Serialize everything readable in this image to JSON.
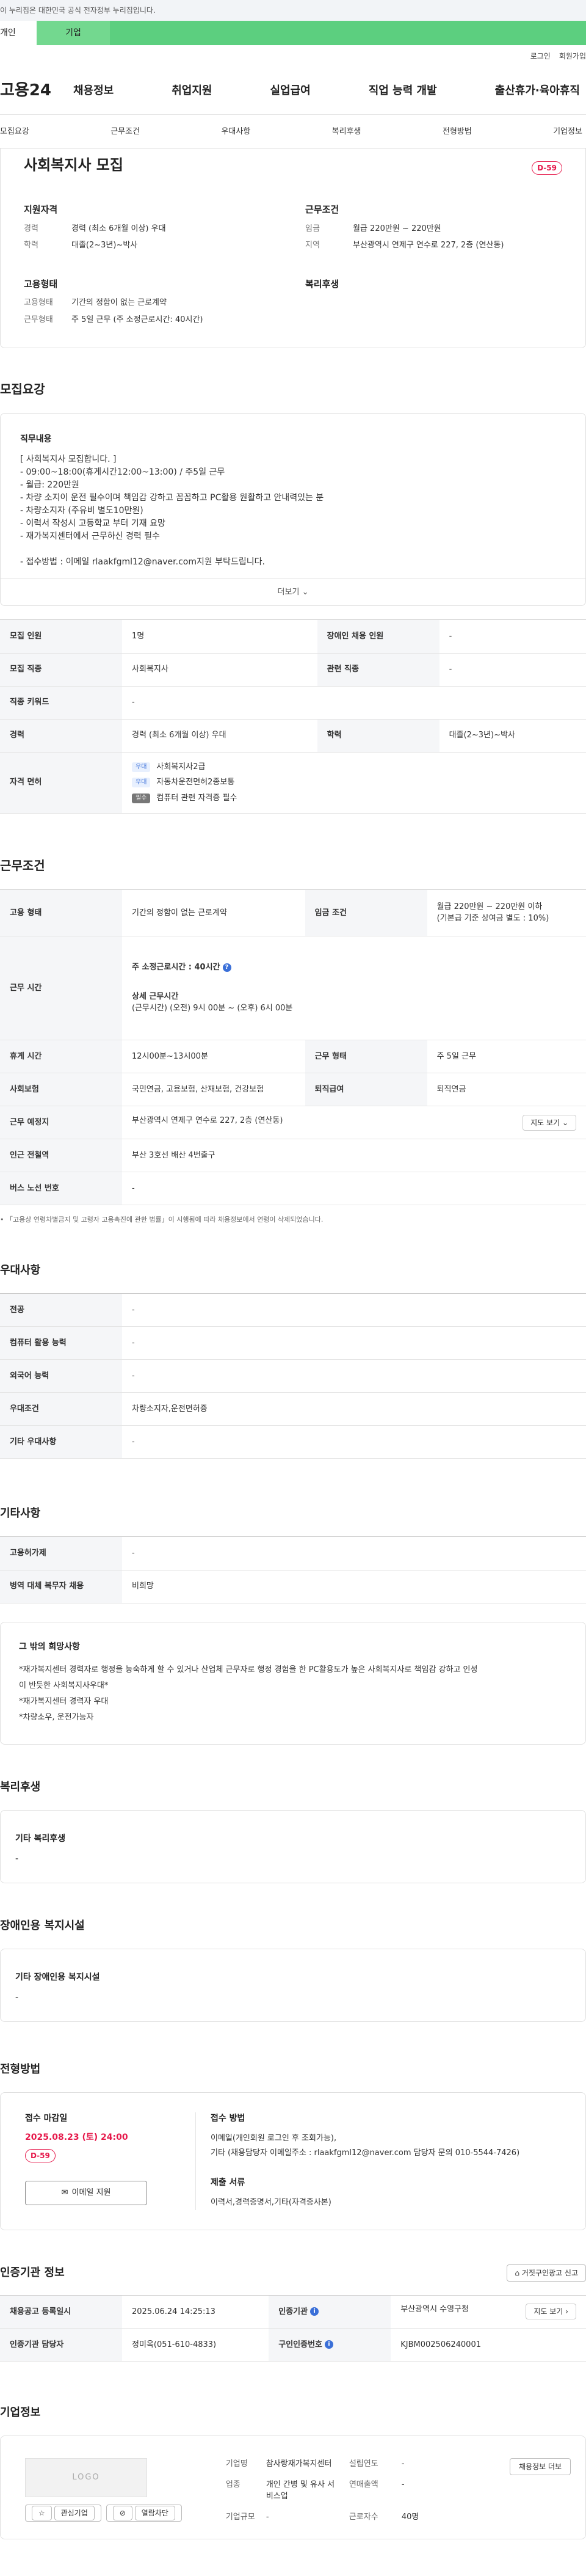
{
  "notice": "이 누리집은 대한민국 공식 전자정부 누리집입니다.",
  "user_tabs": [
    "개인",
    "기업"
  ],
  "util": [
    "로그인",
    "회원가입"
  ],
  "logo": "고용24",
  "gnb": [
    "채용정보",
    "취업지원",
    "실업급여",
    "직업 능력 개발",
    "출산휴가·육아휴직"
  ],
  "subnav": [
    "모집요강",
    "근무조건",
    "우대사항",
    "복리후생",
    "전형방법",
    "기업정보"
  ],
  "summary": {
    "title": "사회복지사 모집",
    "dday": "D-59",
    "qual": {
      "title": "지원자격",
      "rows": [
        {
          "k": "경력",
          "v": "경력 (최소 6개월 이상) 우대"
        },
        {
          "k": "학력",
          "v": "대졸(2~3년)~박사"
        }
      ]
    },
    "cond": {
      "title": "근무조건",
      "rows": [
        {
          "k": "임금",
          "v": "월급 220만원 ~ 220만원"
        },
        {
          "k": "지역",
          "v": "부산광역시 연제구 연수로 227, 2층 (연산동)"
        }
      ]
    },
    "emp": {
      "title": "고용형태",
      "rows": [
        {
          "k": "고용형태",
          "v": "기간의 정함이 없는 근로계약"
        },
        {
          "k": "근무형태",
          "v": "주 5일 근무 (주 소정근로시간: 40시간)"
        }
      ]
    },
    "welfare": {
      "title": "복리후생"
    }
  },
  "recruit": {
    "title": "모집요강",
    "desc_title": "직무내용",
    "desc_lines": [
      "[ 사회복지사 모집합니다. ]",
      "- 09:00~18:00(휴게시간12:00~13:00) / 주5일 근무",
      "- 월급: 220만원",
      "- 차량 소지이 운전 필수이며 책임감 강하고 꼼꼼하고 PC활용 원활하고 안내력있는 분",
      "- 차량소지자 (주유비 별도10만원)",
      "- 이력서 작성시 고등학교 부터 기재 요망",
      "- 재가복지센터에서 근무하신 경력 필수",
      "",
      "- 접수방법 : 이메일 rlaakfgml12@naver.com지원 부탁드립니다."
    ],
    "more": "더보기",
    "headcount_label": "모집 인원",
    "headcount": "1명",
    "disabled_label": "장애인 채용 인원",
    "disabled": "-",
    "job_label": "모집 직종",
    "job": "사회복지사",
    "related_label": "관련 직종",
    "related": "-",
    "keyword_label": "직종 키워드",
    "keyword": "-",
    "career_label": "경력",
    "career": "경력 (최소 6개월 이상) 우대",
    "edu_label": "학력",
    "edu": "대졸(2~3년)~박사",
    "license_label": "자격 면허",
    "licenses": [
      {
        "badge": "우대",
        "name": "사회복지사2급"
      },
      {
        "badge": "우대",
        "name": "자동차운전면허2종보통"
      },
      {
        "badge": "필수",
        "name": "컴퓨터 관련 자격증 필수"
      }
    ]
  },
  "work": {
    "title": "근무조건",
    "type_label": "고용 형태",
    "type": "기간의 정함이 없는 근로계약",
    "wage_label": "임금 조건",
    "wage": "월급 220만원 ~ 220만원 이하",
    "wage_note": "(기본급 기준 상여금 별도 : 10%)",
    "time_label": "근무 시간",
    "weekly": "주 소정근로시간 : 40시간",
    "detail_title": "상세 근무시간",
    "detail": "(근무시간) (오전) 9시 00분 ~ (오후) 6시 00분",
    "break_label": "휴게 시간",
    "break": "12시00분~13시00분",
    "form_label": "근무 형태",
    "form": "주 5일 근무",
    "insurance_label": "사회보험",
    "insurance": "국민연금, 고용보험, 산재보험, 건강보험",
    "retire_label": "퇴직급여",
    "retire": "퇴직연금",
    "place_label": "근무 예정지",
    "place": "부산광역시 연제구 연수로 227, 2층 (연산동)",
    "map": "지도 보기",
    "subway_label": "인근 전철역",
    "subway": "부산 3호선 배산 4번출구",
    "bus_label": "버스 노선 번호",
    "bus": "-",
    "note": "「고용상 연령차별금지 및 고령자 고용촉진에 관한 법률」이 시행됨에 따라 채용정보에서 연령이 삭제되었습니다."
  },
  "pref": {
    "title": "우대사항",
    "rows": [
      {
        "k": "전공",
        "v": "-"
      },
      {
        "k": "컴퓨터 활용 능력",
        "v": "-"
      },
      {
        "k": "외국어 능력",
        "v": "-"
      },
      {
        "k": "우대조건",
        "v": "차량소지자,운전면허증"
      },
      {
        "k": "기타 우대사항",
        "v": "-"
      }
    ]
  },
  "etc": {
    "title": "기타사항",
    "rows": [
      {
        "k": "고용허가제",
        "v": "-"
      },
      {
        "k": "병역 대체 복무자 채용",
        "v": "비희망"
      }
    ],
    "wish_title": "그 밖의 희망사항",
    "wish_lines": [
      "*재가복지센터 경력자로 행정을 능숙하게 할 수 있거나 산업체 근무자로 행정 경험을 한 PC활용도가 높은 사회복지사로 책임감 강하고 인성",
      "이 반듯한 사회복지사우대*",
      "*재가복지센터 경력자 우대",
      "*차량소우, 운전가능자"
    ]
  },
  "welfare": {
    "title": "복리후생",
    "sub": "기타 복리후생",
    "v": "-"
  },
  "facility": {
    "title": "장애인용 복지시설",
    "sub": "기타 장애인용 복지시설",
    "v": "-"
  },
  "apply": {
    "title": "전형방법",
    "deadline_title": "접수 마감일",
    "deadline": "2025.08.23 (토) 24:00",
    "dday": "D-59",
    "btn": "이메일 지원",
    "method_title": "접수 방법",
    "method_lines": [
      "이메일(개인회원 로그인 후 조회가능),",
      "기타 (채용담당자 이메일주소 : rlaakfgml12@naver.com 담당자 문의 010-5544-7426)"
    ],
    "docs_title": "제출 서류",
    "docs": "이력서,경력증명서,기타(자격증사본)"
  },
  "cert": {
    "title": "인증기관 정보",
    "report": "거짓구인광고 신고",
    "reg_label": "채용공고 등록일시",
    "reg": "2025.06.24 14:25:13",
    "org_label": "인증기관",
    "org": "부산광역시 수영구청",
    "map": "지도 보기",
    "mgr_label": "인증기관 담당자",
    "mgr": "정미옥(051-610-4833)",
    "no_label": "구인인증번호",
    "no": "KJBM002506240001"
  },
  "company": {
    "title": "기업정보",
    "logo": "LOGO",
    "fav": "관심기업",
    "block": "열람차단",
    "list": "채용정보 더보",
    "name_label": "기업명",
    "name": "참사랑재가복지센터",
    "year_label": "설립연도",
    "year": "-",
    "industry_label": "업종",
    "industry": "개인 간병 및 유사 서비스업",
    "sales_label": "연매출액",
    "sales": "-",
    "emp_label": "근로자수",
    "emp": "40명",
    "size_label": "기업규모",
    "size": "-"
  }
}
